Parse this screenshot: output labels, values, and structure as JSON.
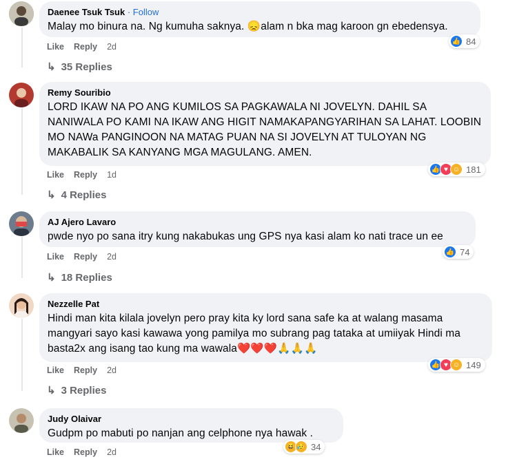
{
  "comments": [
    {
      "name": "Daenee Tsuk Tsuk",
      "follow": "· Follow",
      "text": "Malay mo binura na. Ng kumuha saknya. 😞alam n bka mag karoon gn ebedensya.",
      "like": "Like",
      "reply": "Reply",
      "time": "2d",
      "reactions": [
        "like"
      ],
      "reaction_count": "84",
      "replies": "35 Replies"
    },
    {
      "name": "Remy Souribio",
      "text": "LORD IKAW NA PO ANG KUMILOS SA PAGKAWALA NI JOVELYN. DAHIL SA NANIWALA PO KAMI NA IKAW ANG HIGIT NAMAKAPANGYARIHAN SA LAHAT. LOOBIN MO NAWa PANGINOON NA MATAG PUAN NA SI JOVELYN AT TULOYAN NG MAKABALIK SA KANYANG MGA MAGULANG. AMEN.",
      "like": "Like",
      "reply": "Reply",
      "time": "1d",
      "reactions": [
        "like",
        "love",
        "care"
      ],
      "reaction_count": "181",
      "replies": "4 Replies"
    },
    {
      "name": "AJ Ajero Lavaro",
      "text": "pwde nyo po sana itry kung nakabukas ung GPS nya kasi alam ko nati trace un ee",
      "like": "Like",
      "reply": "Reply",
      "time": "2d",
      "reactions": [
        "like"
      ],
      "reaction_count": "74",
      "replies": "18 Replies"
    },
    {
      "name": "Nezzelle Pat",
      "text": "Hindi man kita kilala jovelyn pero pray kita ky lord sana safe ka at walang masama mangyari sayo kasi kawawa yong pamilya mo subrang pag tataka at umiiyak Hindi ma basta2x ang isang tao kung ma wawala❤️❤️❤️🙏🙏🙏",
      "like": "Like",
      "reply": "Reply",
      "time": "2d",
      "reactions": [
        "like",
        "love",
        "care"
      ],
      "reaction_count": "149",
      "replies": "3 Replies"
    },
    {
      "name": "Judy Olaivar",
      "text": "Gudpm po mabuti po nanjan ang celphone nya hawak .",
      "like": "Like",
      "reply": "Reply",
      "time": "2d",
      "reactions": [
        "haha",
        "sad"
      ],
      "reaction_count": "34"
    }
  ],
  "colors": {
    "bubble": "#f0f2f5",
    "like_blue": "#1877f2",
    "love_red": "#f33e58",
    "follow_blue": "#216fdb",
    "secondary_text": "#65676b"
  }
}
